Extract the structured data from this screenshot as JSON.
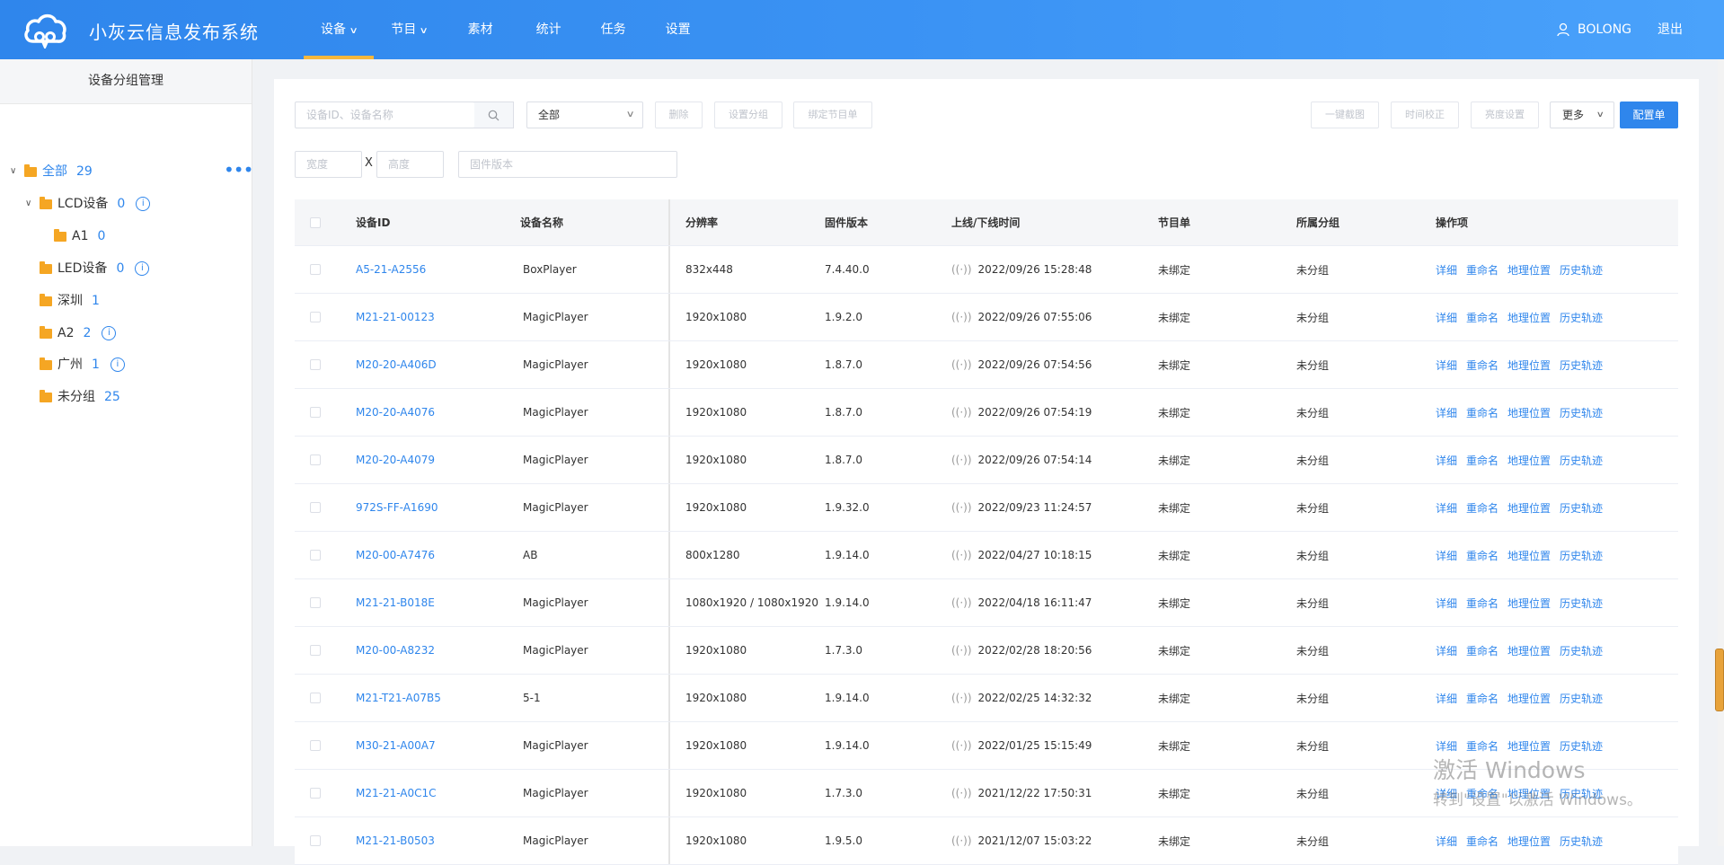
{
  "app": {
    "title": "小灰云信息发布系统"
  },
  "nav": {
    "items": [
      {
        "label": "设备",
        "dropdown": true,
        "active": true
      },
      {
        "label": "节目",
        "dropdown": true,
        "active": false
      },
      {
        "label": "素材",
        "dropdown": false,
        "active": false
      },
      {
        "label": "统计",
        "dropdown": false,
        "active": false
      },
      {
        "label": "任务",
        "dropdown": false,
        "active": false
      },
      {
        "label": "设置",
        "dropdown": false,
        "active": false
      }
    ]
  },
  "user": {
    "name": "BOLONG",
    "logout": "退出"
  },
  "sidebar": {
    "title": "设备分组管理",
    "tree": [
      {
        "label": "全部",
        "count": "29",
        "expanded": true,
        "active": true,
        "info": false
      },
      {
        "label": "LCD设备",
        "count": "0",
        "expanded": true,
        "active": false,
        "info": true
      },
      {
        "label": "A1",
        "count": "0",
        "active": false,
        "info": false
      },
      {
        "label": "LED设备",
        "count": "0",
        "active": false,
        "info": true
      },
      {
        "label": "深圳",
        "count": "1",
        "active": false,
        "info": false
      },
      {
        "label": "A2",
        "count": "2",
        "active": false,
        "info": true
      },
      {
        "label": "广州",
        "count": "1",
        "active": false,
        "info": true
      },
      {
        "label": "未分组",
        "count": "25",
        "active": false,
        "info": false
      }
    ]
  },
  "toolbar": {
    "search_placeholder": "设备ID、设备名称",
    "group_select": "全部",
    "delete": "删除",
    "set_group": "设置分组",
    "bind_program": "绑定节目单",
    "screenshot": "一键截图",
    "time_sync": "时间校正",
    "brightness": "亮度设置",
    "more": "更多",
    "config": "配置单",
    "width_placeholder": "宽度",
    "x_sep": "X",
    "height_placeholder": "高度",
    "firmware_placeholder": "固件版本"
  },
  "table": {
    "headers": {
      "device_id": "设备ID",
      "device_name": "设备名称",
      "resolution": "分辨率",
      "firmware": "固件版本",
      "online_time": "上线/下线时间",
      "program": "节目单",
      "group": "所属分组",
      "ops": "操作项"
    },
    "ops_labels": [
      "详细",
      "重命名",
      "地理位置",
      "历史轨迹"
    ],
    "rows": [
      {
        "id": "A5-21-A2556",
        "name": "BoxPlayer",
        "resolution": "832x448",
        "firmware": "7.4.40.0",
        "time": "2022/09/26 15:28:48",
        "program": "未绑定",
        "group": "未分组"
      },
      {
        "id": "M21-21-00123",
        "name": "MagicPlayer",
        "resolution": "1920x1080",
        "firmware": "1.9.2.0",
        "time": "2022/09/26 07:55:06",
        "program": "未绑定",
        "group": "未分组"
      },
      {
        "id": "M20-20-A406D",
        "name": "MagicPlayer",
        "resolution": "1920x1080",
        "firmware": "1.8.7.0",
        "time": "2022/09/26 07:54:56",
        "program": "未绑定",
        "group": "未分组"
      },
      {
        "id": "M20-20-A4076",
        "name": "MagicPlayer",
        "resolution": "1920x1080",
        "firmware": "1.8.7.0",
        "time": "2022/09/26 07:54:19",
        "program": "未绑定",
        "group": "未分组"
      },
      {
        "id": "M20-20-A4079",
        "name": "MagicPlayer",
        "resolution": "1920x1080",
        "firmware": "1.8.7.0",
        "time": "2022/09/26 07:54:14",
        "program": "未绑定",
        "group": "未分组"
      },
      {
        "id": "972S-FF-A1690",
        "name": "MagicPlayer",
        "resolution": "1920x1080",
        "firmware": "1.9.32.0",
        "time": "2022/09/23 11:24:57",
        "program": "未绑定",
        "group": "未分组"
      },
      {
        "id": "M20-00-A7476",
        "name": "AB",
        "resolution": "800x1280",
        "firmware": "1.9.14.0",
        "time": "2022/04/27 10:18:15",
        "program": "未绑定",
        "group": "未分组"
      },
      {
        "id": "M21-21-B018E",
        "name": "MagicPlayer",
        "resolution": "1080x1920 / 1080x1920",
        "firmware": "1.9.14.0",
        "time": "2022/04/18 16:11:47",
        "program": "未绑定",
        "group": "未分组"
      },
      {
        "id": "M20-00-A8232",
        "name": "MagicPlayer",
        "resolution": "1920x1080",
        "firmware": "1.7.3.0",
        "time": "2022/02/28 18:20:56",
        "program": "未绑定",
        "group": "未分组"
      },
      {
        "id": "M21-T21-A07B5",
        "name": "5-1",
        "resolution": "1920x1080",
        "firmware": "1.9.14.0",
        "time": "2022/02/25 14:32:32",
        "program": "未绑定",
        "group": "未分组"
      },
      {
        "id": "M30-21-A00A7",
        "name": "MagicPlayer",
        "resolution": "1920x1080",
        "firmware": "1.9.14.0",
        "time": "2022/01/25 15:15:49",
        "program": "未绑定",
        "group": "未分组"
      },
      {
        "id": "M21-21-A0C1C",
        "name": "MagicPlayer",
        "resolution": "1920x1080",
        "firmware": "1.7.3.0",
        "time": "2021/12/22 17:50:31",
        "program": "未绑定",
        "group": "未分组"
      },
      {
        "id": "M21-21-B0503",
        "name": "MagicPlayer",
        "resolution": "1920x1080",
        "firmware": "1.9.5.0",
        "time": "2021/12/07 15:03:22",
        "program": "未绑定",
        "group": "未分组"
      }
    ]
  },
  "watermark": {
    "line1": "激活 Windows",
    "line2": "转到\"设置\"以激活 Windows。"
  },
  "colors": {
    "primary": "#2f86ec",
    "accent": "#f6b73c",
    "folder": "#f5a623"
  }
}
